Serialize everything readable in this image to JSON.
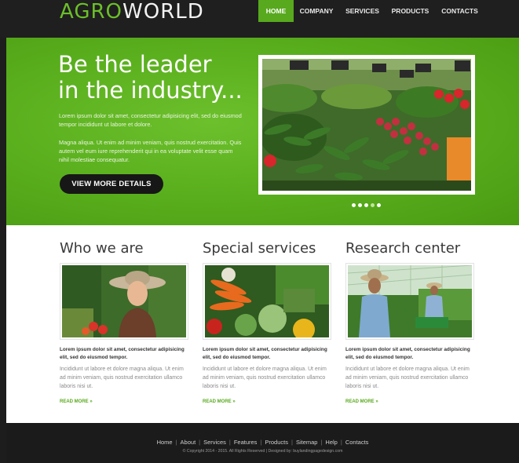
{
  "logo": {
    "part1": "AGRO",
    "part2": "WORLD"
  },
  "nav": [
    {
      "label": "HOME",
      "active": true
    },
    {
      "label": "COMPANY",
      "active": false
    },
    {
      "label": "SERVICES",
      "active": false
    },
    {
      "label": "PRODUCTS",
      "active": false
    },
    {
      "label": "CONTACTS",
      "active": false
    }
  ],
  "hero": {
    "title_line1": "Be the leader",
    "title_line2": "in the industry...",
    "para1": "Lorem ipsum dolor sit amet, consectetur adipisicing elit, sed do eiusmod tempor incididunt ut labore et dolore.",
    "para2": "Magna aliqua. Ut enim ad minim veniam, quis nostrud exercitation. Quis autem vel eum iure reprehenderit qui in ea voluptate velit esse quam nihil molestiae consequatur.",
    "cta_label": "VIEW MORE DETAILS",
    "slide_count": 5,
    "active_slide": 4
  },
  "columns": [
    {
      "heading": "Who we are",
      "lead": "Lorem ipsum dolor sit amet, consectetur adipisicing elit, sed do eiusmod tempor.",
      "body": "Incididunt ut labore et dolore magna aliqua. Ut enim ad minim veniam, quis nostrud exercitation ullamco laboris nisi ut.",
      "more": "READ MORE »"
    },
    {
      "heading": "Special services",
      "lead": "Lorem ipsum dolor sit amet, consectetur adipisicing elit, sed do eiusmod tempor.",
      "body": "Incididunt ut labore et dolore magna aliqua. Ut enim ad minim veniam, quis nostrud exercitation ullamco laboris nisi ut.",
      "more": "READ MORE »"
    },
    {
      "heading": "Research center",
      "lead": "Lorem ipsum dolor sit amet, consectetur adipisicing elit, sed do eiusmod tempor.",
      "body": "Incididunt ut labore et dolore magna aliqua. Ut enim ad minim veniam, quis nostrud exercitation ullamco laboris nisi ut.",
      "more": "READ MORE »"
    }
  ],
  "footer": {
    "links": [
      "Home",
      "About",
      "Services",
      "Features",
      "Products",
      "Sitemap",
      "Help",
      "Contacts"
    ],
    "copyright": "© Copyright 2014 - 2015. All Rights Reserved | Designed by: buylandingpagedesign.com"
  },
  "colors": {
    "accent": "#58a91e",
    "logo_green": "#6cbf2a",
    "header_bg": "#1f1f1f",
    "cta_bg": "#171717"
  }
}
